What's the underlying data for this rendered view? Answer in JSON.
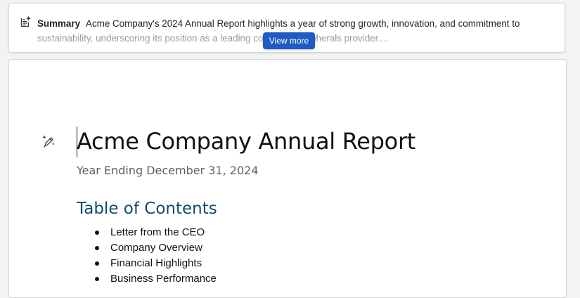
{
  "summary": {
    "label": "Summary",
    "text": "Acme Company's 2024 Annual Report highlights a year of strong growth, innovation, and commitment to sustainability, underscoring its position as a leading computer peripherals provider....",
    "view_more_label": "View more",
    "icon": "summary-sparkle-icon"
  },
  "document": {
    "title": "Acme Company Annual Report",
    "subtitle": "Year Ending December 31, 2024",
    "toc_heading": "Table of Contents",
    "toc_items": [
      "Letter from the CEO",
      "Company Overview",
      "Financial Highlights",
      "Business Performance"
    ],
    "copilot_icon": "copilot-pen-icon"
  },
  "colors": {
    "accent_button": "#1f5bc2",
    "heading": "#104c6b",
    "subtitle": "#5f5f5f"
  }
}
